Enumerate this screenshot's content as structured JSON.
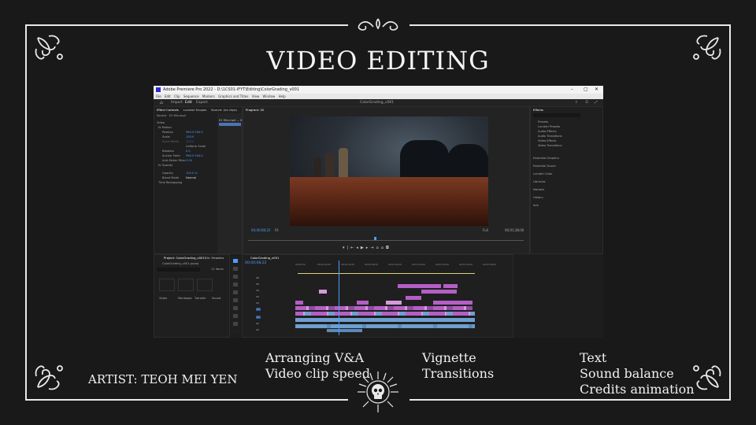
{
  "slide": {
    "title": "VIDEO EDITING",
    "artist": "ARTIST: TEOH MEI YEN",
    "columns": [
      {
        "lines": [
          "Arranging V&A",
          "Video clip speed"
        ]
      },
      {
        "lines": [
          "Vignette",
          "Transitions"
        ]
      },
      {
        "lines": [
          "Text",
          "Sound balance",
          "Credits animation"
        ]
      }
    ]
  },
  "premiere": {
    "window_title": "Adobe Premiere Pro 2022 - D:\\1CS01-IFYT\\Editing\\ColorGrading_v001",
    "window_controls": [
      "–",
      "▢",
      "✕"
    ],
    "menu": [
      "File",
      "Edit",
      "Clip",
      "Sequence",
      "Markers",
      "Graphics and Titles",
      "View",
      "Window",
      "Help"
    ],
    "workspace_tabs": [
      "Import",
      "Edit",
      "Export"
    ],
    "sequence_name": "ColorGrading_v001",
    "left_panel": {
      "tabs": [
        "Effect Controls",
        "Lumetri Scopes",
        "Source: (no clips)"
      ],
      "source_label": "Source · 01 Mix.mp4",
      "rows": [
        "Video",
        "fx  Motion",
        "Position",
        "Scale",
        "Scale Width",
        "Uniform Scale",
        "Rotation",
        "Anchor Point",
        "Anti-flicker Filter",
        "fx  Opacity",
        "Opacity",
        "Blend Mode",
        "Time Remapping"
      ],
      "values": [
        "960.0   540.0",
        "100.0",
        "100.0",
        "0.0",
        "960.0   540.0",
        "0.00",
        "100.0 %",
        "Normal"
      ],
      "clip_label": "01 Mix.mp4 — 01 MP4"
    },
    "program": {
      "tab": "Program: 02",
      "timecode_in": "00;00;08;22",
      "fit": "Fit",
      "full": "Full",
      "timecode_out": "00;01;38;00"
    },
    "effects": {
      "tab": "Effects",
      "search_placeholder": "",
      "folders": [
        "Presets",
        "Lumetri Presets",
        "Audio Effects",
        "Audio Transitions",
        "Video Effects",
        "Video Transitions"
      ],
      "panels": [
        "Essential Graphics",
        "Essential Sound",
        "Lumetri Color",
        "Libraries",
        "Markers",
        "History",
        "Info"
      ]
    },
    "project": {
      "tabs": [
        "Project: ColorGrading_v001",
        "Bin: Headers"
      ],
      "file": "ColorGrading_v001.prproj",
      "count": "11 items",
      "thumb_labels": [
        "Video",
        "Montages",
        "Transfer",
        "Sound"
      ]
    },
    "timeline": {
      "tab": "ColorGrading_v001",
      "timecode": "00;00;08;22",
      "ruler": [
        "00;00;00",
        "00;00;16;00",
        "00;00;32;00",
        "00;00;48;00",
        "00;01;04;00",
        "00;01;20;00",
        "00;01;36;00",
        "00;01;52;00",
        "00;02;08;00"
      ],
      "tracks": [
        "V6",
        "V5",
        "V4",
        "V3",
        "V2",
        "V1",
        "A1",
        "A2",
        "A3"
      ],
      "colors": {
        "video_clip": "#b45fc6",
        "video_clip_light": "#d59ad9",
        "audio_clip": "#6f9fcf",
        "playhead": "#4c9cff",
        "work_area": "#d8d27a"
      }
    }
  }
}
